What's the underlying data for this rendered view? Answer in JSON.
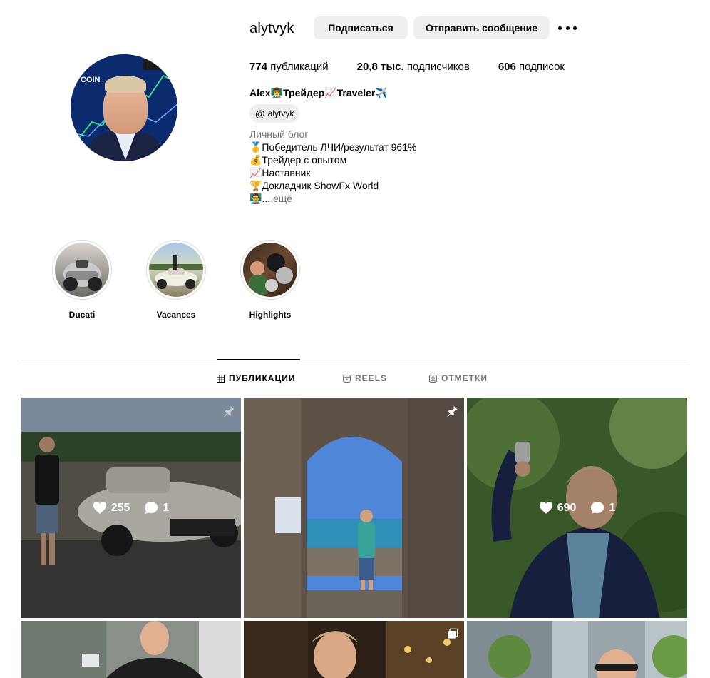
{
  "profile": {
    "username": "alytvyk",
    "follow_label": "Подписаться",
    "message_label": "Отправить сообщение",
    "avatar_text": "COIN"
  },
  "stats": {
    "posts_count": "774",
    "posts_label": "публикаций",
    "followers_count": "20,8 тыс.",
    "followers_label": "подписчиков",
    "following_count": "606",
    "following_label": "подписок"
  },
  "bio": {
    "name": "Alex👨‍🏫Трейдер📈Traveler✈️",
    "threads_handle": "alytvyk",
    "category": "Личный блог",
    "lines": [
      "🥇Победитель ЛЧИ/результат 961%",
      "💰Трейдер с опытом",
      "📈Наставник",
      "🏆Докладчик ShowFx World"
    ],
    "last_prefix": "👨‍🏫...",
    "more_label": "ещё"
  },
  "highlights": [
    {
      "label": "Ducati"
    },
    {
      "label": "Vacances"
    },
    {
      "label": "Highlights"
    }
  ],
  "tabs": [
    {
      "label": "ПУБЛИКАЦИИ",
      "icon": "grid-icon",
      "active": true
    },
    {
      "label": "REELS",
      "icon": "reels-icon",
      "active": false
    },
    {
      "label": "ОТМЕТКИ",
      "icon": "tagged-icon",
      "active": false
    }
  ],
  "posts": [
    {
      "likes": "255",
      "comments": "1",
      "pinned": true
    },
    {
      "pinned": true
    },
    {
      "likes": "690",
      "comments": "1",
      "pinned": false
    },
    {},
    {},
    {}
  ],
  "colors": {
    "button_bg": "#efefef",
    "muted_text": "#737373",
    "divider": "#dbdbdb",
    "selection": "#4a7fd4"
  }
}
